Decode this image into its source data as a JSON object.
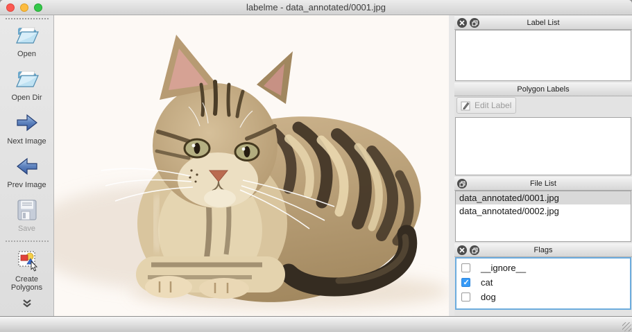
{
  "window": {
    "title": "labelme - data_annotated/0001.jpg"
  },
  "toolbar": {
    "open": "Open",
    "open_dir": "Open Dir",
    "next_image": "Next Image",
    "prev_image": "Prev Image",
    "save": "Save",
    "save_disabled": true,
    "create_polygons": "Create Polygons"
  },
  "docks": {
    "label_list": {
      "title": "Label List",
      "items": []
    },
    "polygon_labels": {
      "title": "Polygon Labels",
      "edit_label_button": "Edit Label",
      "edit_label_disabled": true,
      "items": []
    },
    "file_list": {
      "title": "File List",
      "items": [
        {
          "name": "data_annotated/0001.jpg",
          "selected": true
        },
        {
          "name": "data_annotated/0002.jpg",
          "selected": false
        }
      ]
    },
    "flags": {
      "title": "Flags",
      "items": [
        {
          "label": "__ignore__",
          "checked": false
        },
        {
          "label": "cat",
          "checked": true
        },
        {
          "label": "dog",
          "checked": false
        }
      ]
    }
  },
  "colors": {
    "checkbox_checked": "#389bf7",
    "flags_focus_border": "#6cacde",
    "file_selection": "#d9d9d9",
    "traffic_red": "#fb5a52",
    "traffic_yellow": "#fdbc40",
    "traffic_green": "#34c84a"
  }
}
